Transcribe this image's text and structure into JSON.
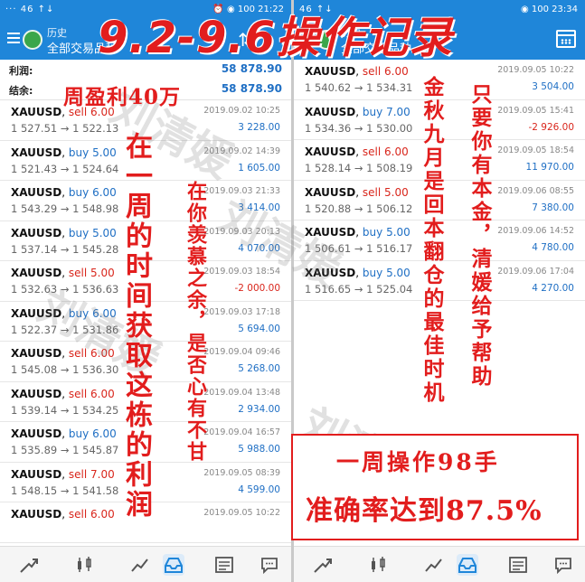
{
  "left": {
    "status": {
      "left": "··· 46 ↑↓",
      "right": "⏰ ◉ 100 21:22"
    },
    "app_bar": {
      "title": "历史",
      "subtitle": "全部交易品种"
    },
    "summary": [
      {
        "label": "利润:",
        "value": "58 878.90"
      },
      {
        "label": "结余:",
        "value": "58 878.90"
      }
    ],
    "trades": [
      {
        "symbol": "XAUUSD",
        "side": "sell",
        "lots": "6.00",
        "prices": "1 527.51 → 1 522.13",
        "date": "2019.09.02 10:25",
        "profit": "3 228.00"
      },
      {
        "symbol": "XAUUSD",
        "side": "buy",
        "lots": "5.00",
        "prices": "1 521.43 → 1 524.64",
        "date": "2019.09.02 14:39",
        "profit": "1 605.00"
      },
      {
        "symbol": "XAUUSD",
        "side": "buy",
        "lots": "6.00",
        "prices": "1 543.29 → 1 548.98",
        "date": "2019.09.03 21:33",
        "profit": "3 414.00"
      },
      {
        "symbol": "XAUUSD",
        "side": "buy",
        "lots": "5.00",
        "prices": "1 537.14 → 1 545.28",
        "date": "2019.09.03 20:13",
        "profit": "4 070.00"
      },
      {
        "symbol": "XAUUSD",
        "side": "sell",
        "lots": "5.00",
        "prices": "1 532.63 → 1 536.63",
        "date": "2019.09.03 18:54",
        "profit": "-2 000.00"
      },
      {
        "symbol": "XAUUSD",
        "side": "buy",
        "lots": "6.00",
        "prices": "1 522.37 → 1 531.86",
        "date": "2019.09.03 17:18",
        "profit": "5 694.00"
      },
      {
        "symbol": "XAUUSD",
        "side": "sell",
        "lots": "6.00",
        "prices": "1 545.08 → 1 536.30",
        "date": "2019.09.04 09:46",
        "profit": "5 268.00"
      },
      {
        "symbol": "XAUUSD",
        "side": "sell",
        "lots": "6.00",
        "prices": "1 539.14 → 1 534.25",
        "date": "2019.09.04 13:48",
        "profit": "2 934.00"
      },
      {
        "symbol": "XAUUSD",
        "side": "buy",
        "lots": "6.00",
        "prices": "1 535.89 → 1 545.87",
        "date": "2019.09.04 16:57",
        "profit": "5 988.00"
      },
      {
        "symbol": "XAUUSD",
        "side": "sell",
        "lots": "7.00",
        "prices": "1 548.15 → 1 541.58",
        "date": "2019.09.05 08:39",
        "profit": "4 599.00"
      },
      {
        "symbol": "XAUUSD",
        "side": "sell",
        "lots": "6.00",
        "prices": "",
        "date": "2019.09.05 10:22",
        "profit": ""
      }
    ]
  },
  "right": {
    "status": {
      "left": "46 ↑↓",
      "right": "◉ 100 23:34"
    },
    "app_bar": {
      "title": "历史",
      "subtitle": "全部交易品种"
    },
    "trades": [
      {
        "symbol": "XAUUSD",
        "side": "sell",
        "lots": "6.00",
        "prices": "1 540.62 → 1 534.31",
        "date": "2019.09.05 10:22",
        "profit": "3 504.00"
      },
      {
        "symbol": "XAUUSD",
        "side": "buy",
        "lots": "7.00",
        "prices": "1 534.36 → 1 530.00",
        "date": "2019.09.05 15:41",
        "profit": "-2 926.00"
      },
      {
        "symbol": "XAUUSD",
        "side": "sell",
        "lots": "6.00",
        "prices": "1 528.14 → 1 508.19",
        "date": "2019.09.05 18:54",
        "profit": "11 970.00"
      },
      {
        "symbol": "XAUUSD",
        "side": "sell",
        "lots": "5.00",
        "prices": "1 520.88 → 1 506.12",
        "date": "2019.09.06 08:55",
        "profit": "7 380.00"
      },
      {
        "symbol": "XAUUSD",
        "side": "buy",
        "lots": "5.00",
        "prices": "1 506.61 → 1 516.17",
        "date": "2019.09.06 14:52",
        "profit": "4 780.00"
      },
      {
        "symbol": "XAUUSD",
        "side": "buy",
        "lots": "5.00",
        "prices": "1 516.65 → 1 525.04",
        "date": "2019.09.06 17:04",
        "profit": "4 270.00"
      }
    ]
  },
  "overlay": {
    "title": "9.2-9.6操作记录",
    "weekly_profit": "周盈利40万",
    "column_1": "在一周的时间获取这栋的利润",
    "column_2": "在你羡慕之余，是否心有不甘",
    "column_3": "金秋九月是回本翻仓的最佳时机",
    "column_4": "只要你有本金，清媛给予帮助",
    "box_line_1": "一周操作98手",
    "box_line_2": "准确率达到87.5%"
  },
  "watermark": "刘清媛",
  "colors": {
    "header": "#1f86d9",
    "buy": "#1f6fc4",
    "sell": "#d9261c",
    "overlay": "#e21d1d"
  },
  "nav_icons": [
    "trend-icon",
    "candlestick-icon",
    "chart-line-icon",
    "history-tray-icon",
    "news-icon",
    "chat-icon"
  ]
}
